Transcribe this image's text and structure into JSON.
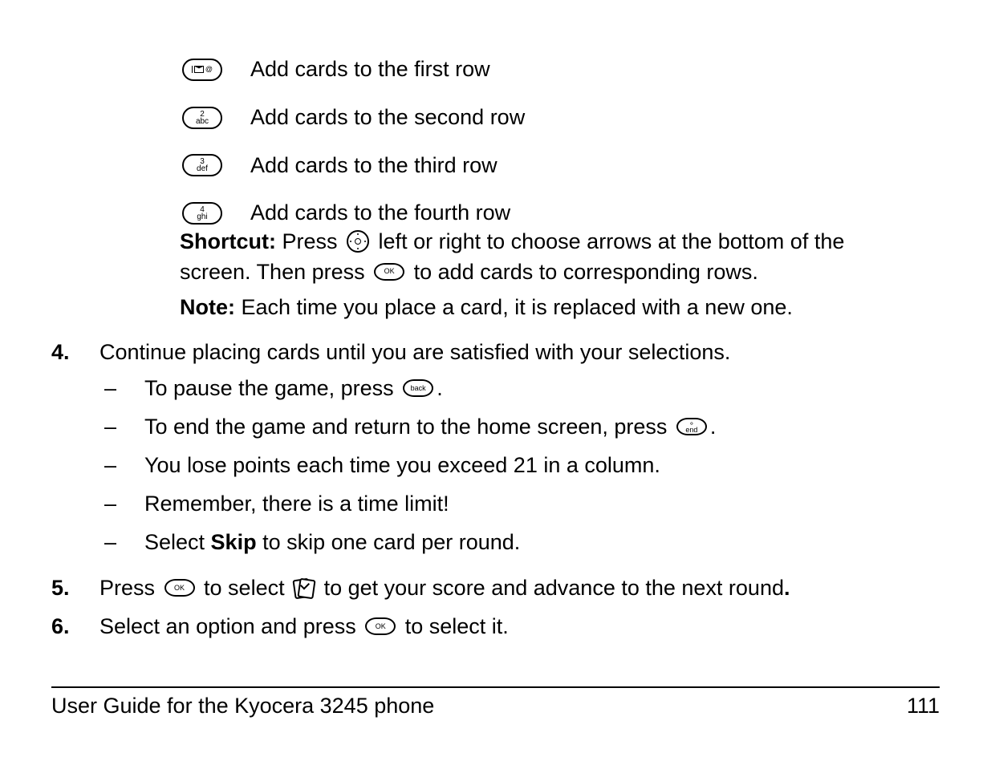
{
  "rows": [
    {
      "key_label": "1",
      "text": "Add cards to the first row"
    },
    {
      "key_label": "2 abc",
      "text": "Add cards to the second row"
    },
    {
      "key_label": "3 def",
      "text": "Add cards to the third row"
    },
    {
      "key_label": "4 ghi",
      "text": "Add cards to the fourth row"
    }
  ],
  "shortcut": {
    "label": "Shortcut:",
    "part1": "Press ",
    "part2": " left or right to choose arrows at the bottom of the screen. Then press ",
    "part3": " to add cards to corresponding rows."
  },
  "note": {
    "label": "Note:",
    "text": "Each time you place a card, it is replaced with a new one."
  },
  "steps": {
    "s4": {
      "num": "4.",
      "text": "Continue placing cards until you are satisfied with your selections.",
      "bullets": [
        {
          "pre": "To pause the game, press ",
          "icon": "back",
          "post": "."
        },
        {
          "pre": "To end the game and return to the home screen, press ",
          "icon": "end",
          "post": "."
        },
        {
          "pre": "You lose points each time you exceed 21 in a column."
        },
        {
          "pre": "Remember, there is a time limit!"
        },
        {
          "pre": "Select ",
          "bold": "Skip",
          "post": " to skip one card per round."
        }
      ]
    },
    "s5": {
      "num": "5.",
      "pre": "Press ",
      "mid": " to select ",
      "post": " to get your score and advance to the next round",
      "end": "."
    },
    "s6": {
      "num": "6.",
      "pre": "Select an option and press ",
      "post": " to select it."
    }
  },
  "icon_text": {
    "ok": "OK",
    "back": "back",
    "end_top": "⚬",
    "end_bot": "end",
    "k2_top": "2",
    "k2_bot": "abc",
    "k3_top": "3",
    "k3_bot": "def",
    "k4_top": "4",
    "k4_bot": "ghi"
  },
  "footer": {
    "left": "User Guide for the Kyocera 3245 phone",
    "right": "111"
  }
}
